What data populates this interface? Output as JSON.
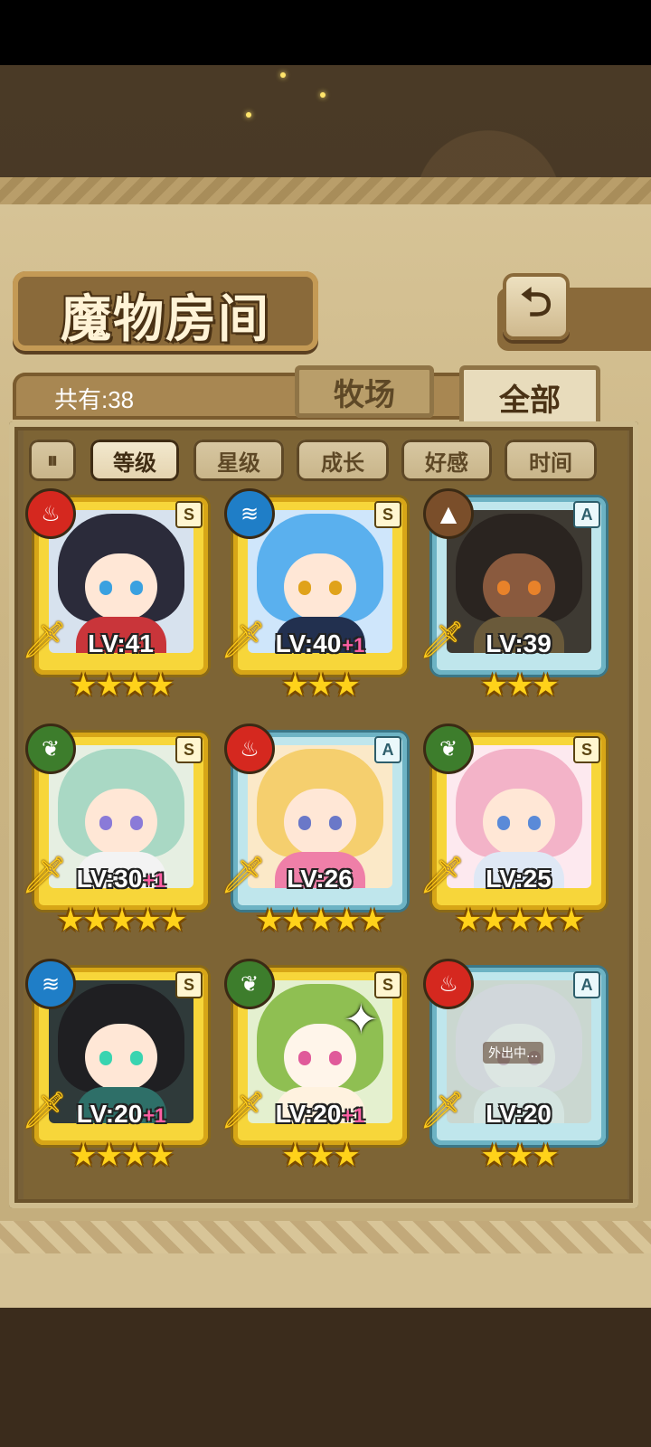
{
  "header": {
    "title": "魔物房间",
    "back_icon": "back-arrow-icon"
  },
  "summary": {
    "count_label": "共有:38"
  },
  "tabs": [
    {
      "label": "牧场",
      "active": false
    },
    {
      "label": "全部",
      "active": true
    }
  ],
  "sort": {
    "toggle_icon": "pause-order-icon",
    "buttons": [
      {
        "label": "等级",
        "active": true
      },
      {
        "label": "星级",
        "active": false
      },
      {
        "label": "成长",
        "active": false
      },
      {
        "label": "好感",
        "active": false
      },
      {
        "label": "时间",
        "active": false
      }
    ]
  },
  "monsters": [
    {
      "element": "fire",
      "rank": "S",
      "level": "LV:41",
      "bonus": "",
      "stars": "★★★★",
      "frame": "gold",
      "away": ""
    },
    {
      "element": "water",
      "rank": "S",
      "level": "LV:40",
      "bonus": "+1",
      "stars": "★★★",
      "frame": "gold",
      "away": ""
    },
    {
      "element": "earth",
      "rank": "A",
      "level": "LV:39",
      "bonus": "",
      "stars": "★★★",
      "frame": "blue",
      "away": ""
    },
    {
      "element": "wood",
      "rank": "S",
      "level": "LV:30",
      "bonus": "+1",
      "stars": "★★★★★",
      "frame": "gold",
      "away": ""
    },
    {
      "element": "fire",
      "rank": "A",
      "level": "LV:26",
      "bonus": "",
      "stars": "★★★★★",
      "frame": "blue",
      "away": ""
    },
    {
      "element": "wood",
      "rank": "S",
      "level": "LV:25",
      "bonus": "",
      "stars": "★★★★★",
      "frame": "gold",
      "away": ""
    },
    {
      "element": "water",
      "rank": "S",
      "level": "LV:20",
      "bonus": "+1",
      "stars": "★★★★",
      "frame": "gold",
      "away": ""
    },
    {
      "element": "wood",
      "rank": "S",
      "level": "LV:20",
      "bonus": "+1",
      "stars": "★★★",
      "frame": "gold",
      "away": ""
    },
    {
      "element": "fire",
      "rank": "A",
      "level": "LV:20",
      "bonus": "",
      "stars": "★★★",
      "frame": "blue",
      "away": "外出中..."
    }
  ],
  "colors": {
    "fire": "#d5281f",
    "water": "#1f7ec7",
    "earth": "#7a4e2a",
    "wood": "#3d7d2c"
  }
}
